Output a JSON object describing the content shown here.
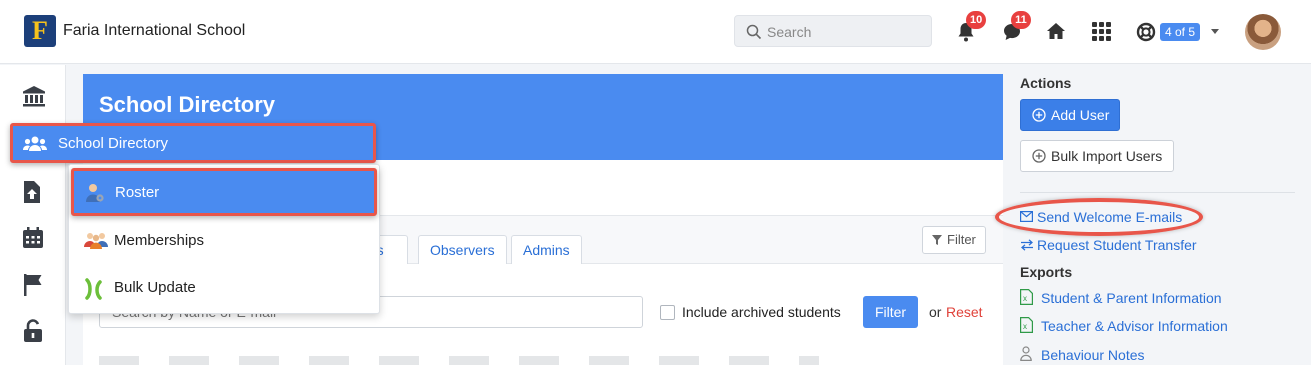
{
  "header": {
    "school_name": "Faria International School",
    "search_placeholder": "Search",
    "notifications_count": "10",
    "messages_count": "11",
    "pager": "4 of 5"
  },
  "main": {
    "title": "School Directory",
    "tabs": [
      "nts",
      "Observers",
      "Admins"
    ],
    "filter_toggle_label": "Filter",
    "search_placeholder": "Search by Name or E-mail",
    "include_archived_label": "Include archived students",
    "filter_button": "Filter",
    "or_text": "or",
    "reset_link": "Reset"
  },
  "dropdown": {
    "parent_label": "School Directory",
    "items": [
      {
        "label": "Roster"
      },
      {
        "label": "Memberships"
      },
      {
        "label": "Bulk Update"
      }
    ]
  },
  "right_panel": {
    "actions_label": "Actions",
    "add_user_button": "Add User",
    "bulk_import_button": "Bulk Import Users",
    "links": [
      "Send Welcome E-mails",
      "Request Student Transfer"
    ],
    "exports_label": "Exports",
    "exports": [
      "Student & Parent Information",
      "Teacher & Advisor Information",
      "Behaviour Notes"
    ]
  },
  "colors": {
    "accent": "#4a8bf0",
    "highlight": "#e8564a",
    "link": "#2a6fd6",
    "badge": "#e8403f"
  }
}
